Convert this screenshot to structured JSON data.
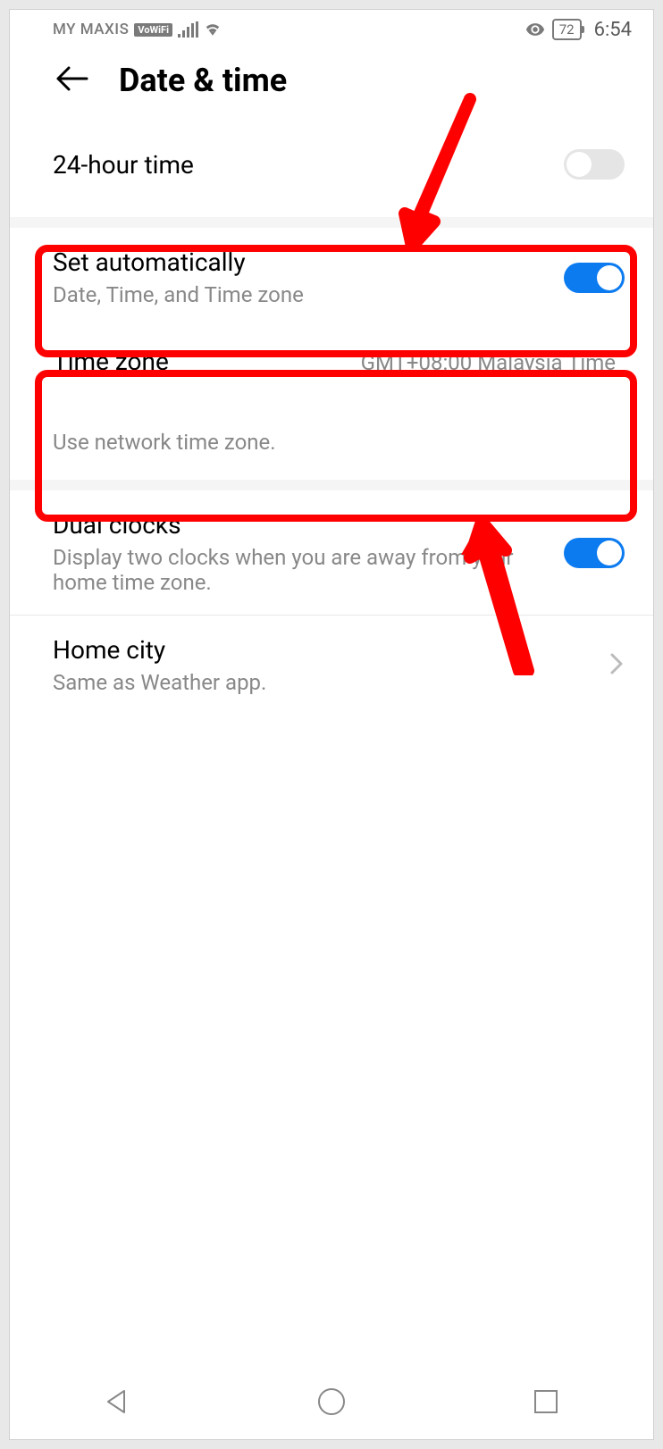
{
  "status_bar": {
    "carrier": "MY MAXIS",
    "vowifi_badge": "VoWiFi",
    "battery": "72",
    "time": "6:54"
  },
  "header": {
    "title": "Date & time"
  },
  "settings": {
    "twentyfour_hour": {
      "title": "24-hour time"
    },
    "set_auto": {
      "title": "Set automatically",
      "subtitle": "Date, Time, and Time zone"
    },
    "timezone": {
      "title": "Time zone",
      "value": "GMT+08:00 Malaysia Time",
      "description": "Use network time zone."
    },
    "dual_clocks": {
      "title": "Dual clocks",
      "subtitle": "Display two clocks when you are away from your home time zone."
    },
    "home_city": {
      "title": "Home city",
      "subtitle": "Same as Weather app."
    }
  }
}
